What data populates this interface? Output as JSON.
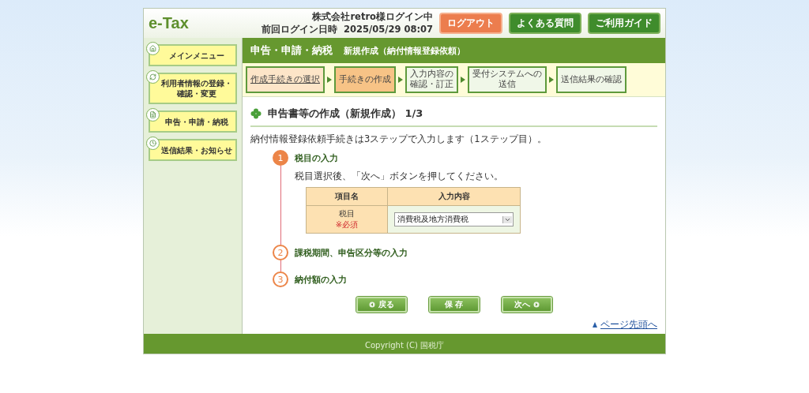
{
  "header": {
    "logo": "e-Tax",
    "user": "株式会社retro様ログイン中",
    "last_login_label": "前回ログイン日時",
    "last_login": "2025/05/29 08:07",
    "buttons": [
      {
        "label": "ログアウト",
        "kind": "logout"
      },
      {
        "label": "よくある質問",
        "kind": "nav"
      },
      {
        "label": "ご利用ガイド",
        "kind": "nav"
      }
    ]
  },
  "sidebar": {
    "items": [
      {
        "label": "メインメニュー"
      },
      {
        "label": "利用者情報の登録・確認・変更"
      },
      {
        "label": "申告・申請・納税"
      },
      {
        "label": "送信結果・お知らせ"
      }
    ]
  },
  "title_bar": {
    "section": "申告・申請・納税",
    "subtitle": "新規作成（納付情報登録依頼）"
  },
  "progress_steps": [
    {
      "lines": [
        "作成手続きの選択"
      ],
      "selected": false,
      "link": true
    },
    {
      "lines": [
        "手続きの作成"
      ],
      "selected": true,
      "link": false
    },
    {
      "lines": [
        "入力内容の",
        "確認・訂正"
      ],
      "selected": false,
      "link": false
    },
    {
      "lines": [
        "受付システムへの",
        "送信"
      ],
      "selected": false,
      "link": false
    },
    {
      "lines": [
        "送信結果の確認"
      ],
      "selected": false,
      "link": false
    }
  ],
  "heading": "申告書等の作成（新規作成） 1/3",
  "intro": "納付情報登録依頼手続きは3ステップで入力します（1ステップ目）。",
  "steps": [
    {
      "number": "1",
      "title": "税目の入力",
      "active": true,
      "instruction": "税目選択後、「次へ」ボタンを押してください。",
      "table": {
        "columns": [
          "項目名",
          "入力内容"
        ],
        "rows": [
          {
            "label": "税目",
            "required": "※必須",
            "value": "消費税及地方消費税"
          }
        ]
      }
    },
    {
      "number": "2",
      "title": "課税期間、申告区分等の入力",
      "active": false
    },
    {
      "number": "3",
      "title": "納付額の入力",
      "active": false
    }
  ],
  "actions": [
    {
      "label": "戻る",
      "kind": "back"
    },
    {
      "label": "保 存",
      "kind": "save"
    },
    {
      "label": "次へ",
      "kind": "next"
    }
  ],
  "page_top_link": "ページ先頭へ",
  "footer": "Copyright (C) 国税庁"
}
